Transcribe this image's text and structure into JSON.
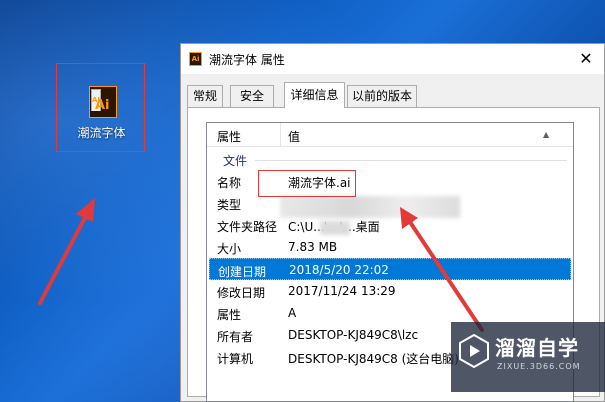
{
  "desktop": {
    "icon_label": "潮流字体",
    "icon_badge_small": "AI",
    "icon_badge_big": "Ai"
  },
  "dialog": {
    "title": "潮流字体 属性",
    "title_icon_badge": "Ai",
    "close_glyph": "✕",
    "tabs": [
      {
        "label": "常规",
        "active": false
      },
      {
        "label": "安全",
        "active": false
      },
      {
        "label": "详细信息",
        "active": true
      },
      {
        "label": "以前的版本",
        "active": false
      }
    ],
    "list": {
      "header_property": "属性",
      "header_value": "值",
      "group": "文件",
      "rows": [
        {
          "key": "名称",
          "value": "潮流字体.ai"
        },
        {
          "key": "类型",
          "value": ""
        },
        {
          "key": "文件夹路径",
          "value": "C:\\U...\\...\\...桌面"
        },
        {
          "key": "大小",
          "value": "7.83 MB"
        },
        {
          "key": "创建日期",
          "value": "2018/5/20 22:02",
          "selected": true
        },
        {
          "key": "修改日期",
          "value": "2017/11/24 13:29"
        },
        {
          "key": "属性",
          "value": "A"
        },
        {
          "key": "所有者",
          "value": "DESKTOP-KJ849C8\\lzc"
        },
        {
          "key": "计算机",
          "value": "DESKTOP-KJ849C8 (这台电脑)"
        }
      ]
    }
  },
  "watermark": {
    "brand": "溜溜自学",
    "url": "ZIXUE.3D66.COM"
  },
  "colors": {
    "highlight": "#0078d7",
    "annotation": "#e23a3a",
    "ai_orange": "#ff9a00"
  }
}
